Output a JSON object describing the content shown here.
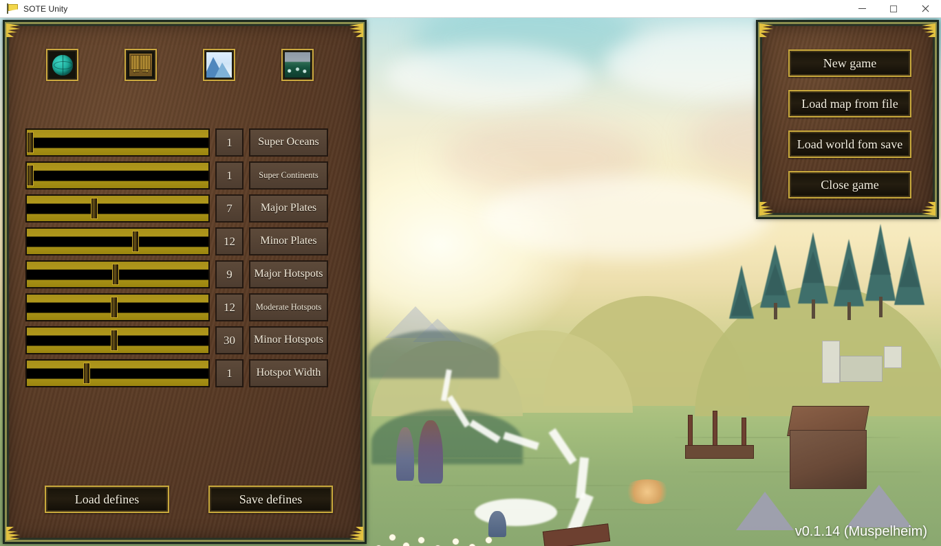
{
  "window": {
    "title": "SOTE Unity",
    "icon": "flag-icon",
    "controls": {
      "minimize": "minimize-icon",
      "maximize": "maximize-icon",
      "close": "close-icon"
    }
  },
  "left_panel": {
    "tabs": [
      {
        "id": "globe",
        "icon": "globe-icon",
        "title": "Planet"
      },
      {
        "id": "plates",
        "icon": "plates-icon",
        "title": "Tectonics"
      },
      {
        "id": "terrain",
        "icon": "mountain-icon",
        "title": "Terrain"
      },
      {
        "id": "ocean",
        "icon": "ocean-icon",
        "title": "Ocean"
      }
    ],
    "sliders": [
      {
        "label": "Super Oceans",
        "value": "1",
        "percent": 2.0,
        "small": false
      },
      {
        "label": "Super Continents",
        "value": "1",
        "percent": 2.0,
        "small": true
      },
      {
        "label": "Major Plates",
        "value": "7",
        "percent": 37.0,
        "small": false
      },
      {
        "label": "Minor Plates",
        "value": "12",
        "percent": 60.0,
        "small": false
      },
      {
        "label": "Major Hotspots",
        "value": "9",
        "percent": 49.0,
        "small": false
      },
      {
        "label": "Moderate Hotspots",
        "value": "12",
        "percent": 48.0,
        "small": true
      },
      {
        "label": "Minor Hotspots",
        "value": "30",
        "percent": 48.0,
        "small": false
      },
      {
        "label": "Hotspot Width",
        "value": "1",
        "percent": 33.0,
        "small": false
      }
    ],
    "actions": {
      "load_defines": "Load  defines",
      "save_defines": "Save defines"
    }
  },
  "right_panel": {
    "menu": [
      "New game",
      "Load map from file",
      "Load world fom save",
      "Close game"
    ]
  },
  "overlay": {
    "version": "v0.1.14 (Muspelheim)"
  },
  "colors": {
    "panel_wood": "#5b3c26",
    "panel_gold": "#c9a93c",
    "panel_border_green": "#2a3326",
    "slider_track": "#a89019",
    "slider_groove": "#000000",
    "button_face": "#4e3d30",
    "text_light": "#f2ead9"
  }
}
